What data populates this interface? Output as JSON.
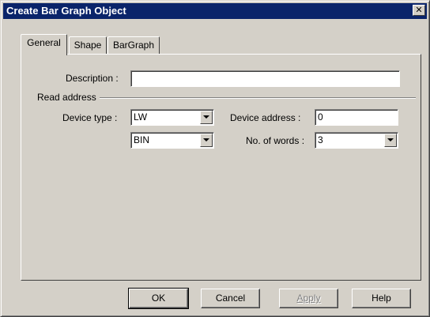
{
  "window": {
    "title": "Create Bar Graph Object",
    "close_glyph": "✕"
  },
  "tabs": [
    {
      "label": "General",
      "active": true
    },
    {
      "label": "Shape",
      "active": false
    },
    {
      "label": "BarGraph",
      "active": false
    }
  ],
  "form": {
    "description_label": "Description :",
    "description_value": "",
    "group_label": "Read address",
    "device_type_label": "Device type :",
    "device_type_value": "LW",
    "format_value": "BIN",
    "device_address_label": "Device address :",
    "device_address_value": "0",
    "words_label": "No. of words :",
    "words_value": "3"
  },
  "buttons": {
    "ok": "OK",
    "cancel": "Cancel",
    "apply": "Apply",
    "help": "Help"
  },
  "colors": {
    "titlebar": "#0a246a",
    "face": "#d4d0c8"
  }
}
